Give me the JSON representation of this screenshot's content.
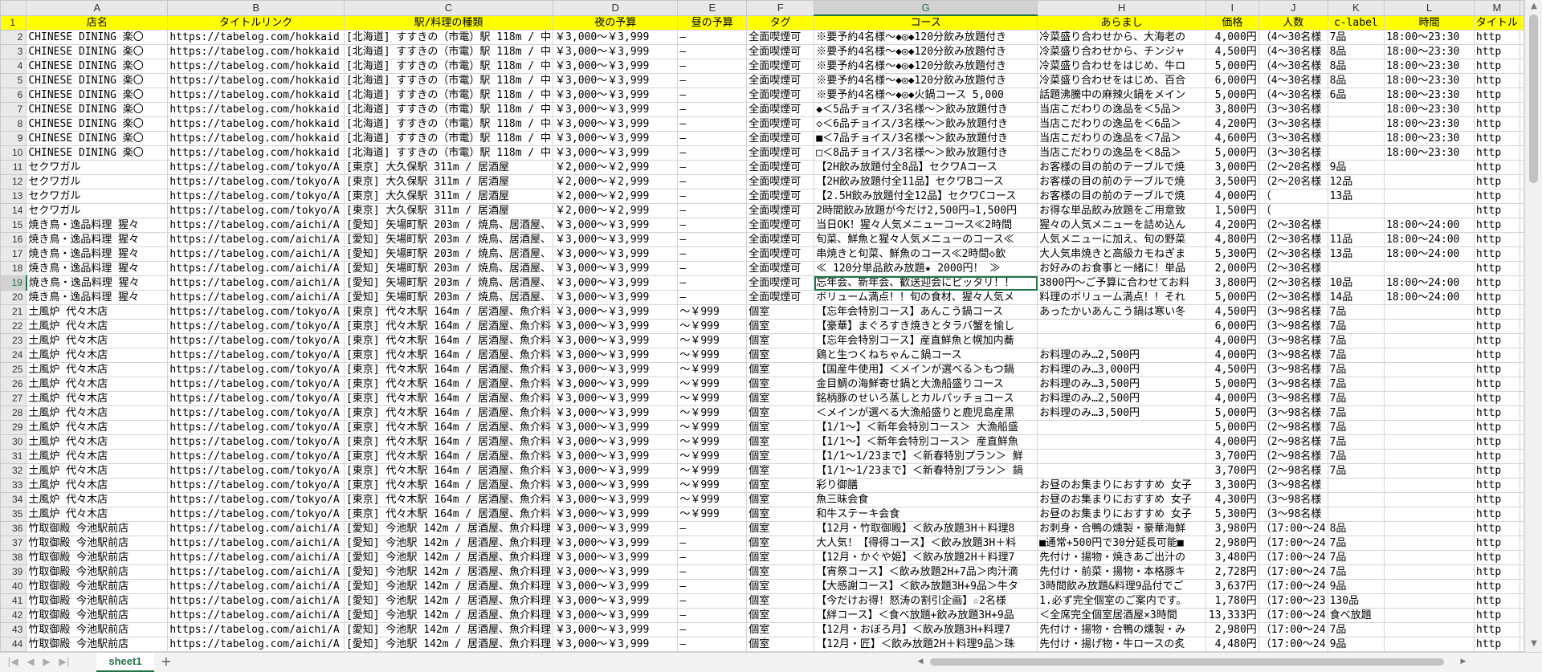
{
  "sheet": {
    "tab_label": "sheet1",
    "selected_cell": "G19"
  },
  "columns": [
    "A",
    "B",
    "C",
    "D",
    "E",
    "F",
    "G",
    "H",
    "I",
    "J",
    "K",
    "L",
    "M"
  ],
  "header_row": [
    "店名",
    "タイトルリンク",
    "駅/料理の種類",
    "夜の予算",
    "昼の予算",
    "タグ",
    "コース",
    "あらまし",
    "価格",
    "人数",
    "c-label",
    "時間",
    "タイトル"
  ],
  "rows": [
    [
      "CHINESE DINING 楽〇",
      "https://tabelog.com/hokkaid",
      "[北海道] すすきの（市電）駅 118m / 中",
      "￥3,000～￥3,999",
      "–",
      "全面喫煙可",
      "※要予約4名様～◆◎◆120分飲み放題付き",
      "冷菜盛り合わせから、大海老の",
      "4,000円",
      "（4～30名様",
      "7品",
      "18:00～23:30",
      "http"
    ],
    [
      "CHINESE DINING 楽〇",
      "https://tabelog.com/hokkaid",
      "[北海道] すすきの（市電）駅 118m / 中",
      "￥3,000～￥3,999",
      "–",
      "全面喫煙可",
      "※要予約4名様～◆◎◆120分飲み放題付き",
      "冷菜盛り合わせから、チンジャ",
      "4,500円",
      "（4～30名様",
      "8品",
      "18:00～23:30",
      "http"
    ],
    [
      "CHINESE DINING 楽〇",
      "https://tabelog.com/hokkaid",
      "[北海道] すすきの（市電）駅 118m / 中",
      "￥3,000～￥3,999",
      "–",
      "全面喫煙可",
      "※要予約4名様～◆◎◆120分飲み放題付き",
      "冷菜盛り合わせをはじめ、牛ロ",
      "5,000円",
      "（4～30名様",
      "8品",
      "18:00～23:30",
      "http"
    ],
    [
      "CHINESE DINING 楽〇",
      "https://tabelog.com/hokkaid",
      "[北海道] すすきの（市電）駅 118m / 中",
      "￥3,000～￥3,999",
      "–",
      "全面喫煙可",
      "※要予約4名様～◆◎◆120分飲み放題付き",
      "冷菜盛り合わせをはじめ、百合",
      "6,000円",
      "（4～30名様",
      "8品",
      "18:00～23:30",
      "http"
    ],
    [
      "CHINESE DINING 楽〇",
      "https://tabelog.com/hokkaid",
      "[北海道] すすきの（市電）駅 118m / 中",
      "￥3,000～￥3,999",
      "–",
      "全面喫煙可",
      "※要予約4名様～◆◎◆火鍋コース 5,000",
      "話題沸騰中の麻辣火鍋をメイン",
      "5,000円",
      "（4～30名様",
      "6品",
      "18:00～23:30",
      "http"
    ],
    [
      "CHINESE DINING 楽〇",
      "https://tabelog.com/hokkaid",
      "[北海道] すすきの（市電）駅 118m / 中",
      "￥3,000～￥3,999",
      "–",
      "全面喫煙可",
      "◆＜5品チョイス/3名様～＞飲み放題付き",
      "当店こだわりの逸品を＜5品＞",
      "3,800円",
      "（3～30名様",
      "",
      "18:00～23:30",
      "http"
    ],
    [
      "CHINESE DINING 楽〇",
      "https://tabelog.com/hokkaid",
      "[北海道] すすきの（市電）駅 118m / 中",
      "￥3,000～￥3,999",
      "–",
      "全面喫煙可",
      "◇＜6品チョイス/3名様～＞飲み放題付き",
      "当店こだわりの逸品を＜6品＞",
      "4,200円",
      "（3～30名様",
      "",
      "18:00～23:30",
      "http"
    ],
    [
      "CHINESE DINING 楽〇",
      "https://tabelog.com/hokkaid",
      "[北海道] すすきの（市電）駅 118m / 中",
      "￥3,000～￥3,999",
      "–",
      "全面喫煙可",
      "■＜7品チョイス/3名様～＞飲み放題付き",
      "当店こだわりの逸品を＜7品＞",
      "4,600円",
      "（3～30名様",
      "",
      "18:00～23:30",
      "http"
    ],
    [
      "CHINESE DINING 楽〇",
      "https://tabelog.com/hokkaid",
      "[北海道] すすきの（市電）駅 118m / 中",
      "￥3,000～￥3,999",
      "–",
      "全面喫煙可",
      "□＜8品チョイス/3名様～＞飲み放題付き",
      "当店こだわりの逸品を＜8品＞",
      "5,000円",
      "（3～30名様",
      "",
      "18:00～23:30",
      "http"
    ],
    [
      "セクワガル",
      "https://tabelog.com/tokyo/A",
      "[東京] 大久保駅 311m / 居酒屋",
      "￥2,000～￥2,999",
      "–",
      "全面喫煙可",
      "【2H飲み放題付全8品】セクワAコース",
      "お客様の目の前のテーブルで焼",
      "3,000円",
      "（2～20名様",
      "9品",
      "",
      "http"
    ],
    [
      "セクワガル",
      "https://tabelog.com/tokyo/A",
      "[東京] 大久保駅 311m / 居酒屋",
      "￥2,000～￥2,999",
      "–",
      "全面喫煙可",
      "【2H飲み放題付全11品】セクワBコース",
      "お客様の目の前のテーブルで焼",
      "3,500円",
      "（2～20名様",
      "12品",
      "",
      "http"
    ],
    [
      "セクワガル",
      "https://tabelog.com/tokyo/A",
      "[東京] 大久保駅 311m / 居酒屋",
      "￥2,000～￥2,999",
      "–",
      "全面喫煙可",
      "【2.5H飲み放題付全12品】セクワCコース",
      "お客様の目の前のテーブルで焼",
      "4,000円",
      "（",
      "13品",
      "",
      "http"
    ],
    [
      "セクワガル",
      "https://tabelog.com/tokyo/A",
      "[東京] 大久保駅 311m / 居酒屋",
      "￥2,000～￥2,999",
      "–",
      "全面喫煙可",
      "2時間飲み放題が今だけ2,500円⇒1,500円",
      "お得な単品飲み放題をご用意致",
      "1,500円",
      "（",
      "",
      "",
      "http"
    ],
    [
      "焼き鳥・逸品料理 猩々",
      "https://tabelog.com/aichi/A",
      "[愛知] 矢場町駅 203m / 焼鳥、居酒屋、",
      "￥3,000～￥3,999",
      "–",
      "全面喫煙可",
      "当日OK！猩々人気メニューコース≪2時間",
      "猩々の人気メニューを詰め込ん",
      "4,200円",
      "（2～30名様",
      "",
      "18:00～24:00",
      "http"
    ],
    [
      "焼き鳥・逸品料理 猩々",
      "https://tabelog.com/aichi/A",
      "[愛知] 矢場町駅 203m / 焼鳥、居酒屋、",
      "￥3,000～￥3,999",
      "–",
      "全面喫煙可",
      "旬菜、鮮魚と猩々人気メニューのコース≪",
      "人気メニューに加え、旬の野菜",
      "4,800円",
      "（2～30名様",
      "11品",
      "18:00～24:00",
      "http"
    ],
    [
      "焼き鳥・逸品料理 猩々",
      "https://tabelog.com/aichi/A",
      "[愛知] 矢場町駅 203m / 焼鳥、居酒屋、",
      "￥3,000～￥3,999",
      "–",
      "全面喫煙可",
      "串焼きと旬菜、鮮魚のコース≪2時間◇飲",
      "大人気串焼きと高級カモねぎま",
      "5,300円",
      "（2～30名様",
      "13品",
      "18:00～24:00",
      "http"
    ],
    [
      "焼き鳥・逸品料理 猩々",
      "https://tabelog.com/aichi/A",
      "[愛知] 矢場町駅 203m / 焼鳥、居酒屋、",
      "￥3,000～￥3,999",
      "–",
      "全面喫煙可",
      "≪ 120分単品飲み放題★ 2000円！ ≫",
      "お好みのお食事と一緒に！単品",
      "2,000円",
      "（2～30名様",
      "",
      "",
      "http"
    ],
    [
      "焼き鳥・逸品料理 猩々",
      "https://tabelog.com/aichi/A",
      "[愛知] 矢場町駅 203m / 焼鳥、居酒屋、",
      "￥3,000～￥3,999",
      "–",
      "全面喫煙可",
      "忘年会、新年会、歓送迎会にピッタリ！！",
      "3800円～ご予算に合わせてお料",
      "3,800円",
      "（2～30名様",
      "10品",
      "18:00～24:00",
      "http"
    ],
    [
      "焼き鳥・逸品料理 猩々",
      "https://tabelog.com/aichi/A",
      "[愛知] 矢場町駅 203m / 焼鳥、居酒屋、",
      "￥3,000～￥3,999",
      "–",
      "全面喫煙可",
      "ボリューム満点！！旬の食材、猩々人気メ",
      "料理のボリューム満点！！それ",
      "5,000円",
      "（2～30名様",
      "14品",
      "18:00～24:00",
      "http"
    ],
    [
      "土風炉 代々木店",
      "https://tabelog.com/tokyo/A",
      "[東京] 代々木駅 164m / 居酒屋、魚介料",
      "￥3,000～￥3,999",
      "～￥999",
      "個室",
      "【忘年会特別コース】あんこう鍋コース",
      "あったかいあんこう鍋は寒い冬",
      "4,500円",
      "（3～98名様",
      "7品",
      "",
      "http"
    ],
    [
      "土風炉 代々木店",
      "https://tabelog.com/tokyo/A",
      "[東京] 代々木駅 164m / 居酒屋、魚介料",
      "￥3,000～￥3,999",
      "～￥999",
      "個室",
      "【豪華】まぐろすき焼きとタラバ蟹を愉し",
      "",
      "6,000円",
      "（3～98名様",
      "7品",
      "",
      "http"
    ],
    [
      "土風炉 代々木店",
      "https://tabelog.com/tokyo/A",
      "[東京] 代々木駅 164m / 居酒屋、魚介料",
      "￥3,000～￥3,999",
      "～￥999",
      "個室",
      "【忘年会特別コース】産直鮮魚と幌加内蕎",
      "",
      "4,000円",
      "（3～98名様",
      "7品",
      "",
      "http"
    ],
    [
      "土風炉 代々木店",
      "https://tabelog.com/tokyo/A",
      "[東京] 代々木駅 164m / 居酒屋、魚介料",
      "￥3,000～￥3,999",
      "～￥999",
      "個室",
      "鶏と生つくねちゃんこ鍋コース",
      "お料理のみ…2,500円",
      "4,000円",
      "（3～98名様",
      "7品",
      "",
      "http"
    ],
    [
      "土風炉 代々木店",
      "https://tabelog.com/tokyo/A",
      "[東京] 代々木駅 164m / 居酒屋、魚介料",
      "￥3,000～￥3,999",
      "～￥999",
      "個室",
      "【国産牛使用】＜メインが選べる＞もつ鍋",
      "お料理のみ…3,000円",
      "4,500円",
      "（3～98名様",
      "7品",
      "",
      "http"
    ],
    [
      "土風炉 代々木店",
      "https://tabelog.com/tokyo/A",
      "[東京] 代々木駅 164m / 居酒屋、魚介料",
      "￥3,000～￥3,999",
      "～￥999",
      "個室",
      "金目鯛の海鮮寄せ鍋と大漁船盛りコース",
      "お料理のみ…3,500円",
      "5,000円",
      "（3～98名様",
      "7品",
      "",
      "http"
    ],
    [
      "土風炉 代々木店",
      "https://tabelog.com/tokyo/A",
      "[東京] 代々木駅 164m / 居酒屋、魚介料",
      "￥3,000～￥3,999",
      "～￥999",
      "個室",
      "銘柄豚のせいろ蒸しとカルパッチョコース",
      "お料理のみ…2,500円",
      "4,000円",
      "（3～98名様",
      "7品",
      "",
      "http"
    ],
    [
      "土風炉 代々木店",
      "https://tabelog.com/tokyo/A",
      "[東京] 代々木駅 164m / 居酒屋、魚介料",
      "￥3,000～￥3,999",
      "～￥999",
      "個室",
      "＜メインが選べる大漁船盛りと鹿児島産黒",
      "お料理のみ…3,500円",
      "5,000円",
      "（3～98名様",
      "7品",
      "",
      "http"
    ],
    [
      "土風炉 代々木店",
      "https://tabelog.com/tokyo/A",
      "[東京] 代々木駅 164m / 居酒屋、魚介料",
      "￥3,000～￥3,999",
      "～￥999",
      "個室",
      "【1/1～】＜新年会特別コース＞ 大漁船盛",
      "",
      "5,000円",
      "（2～98名様",
      "7品",
      "",
      "http"
    ],
    [
      "土風炉 代々木店",
      "https://tabelog.com/tokyo/A",
      "[東京] 代々木駅 164m / 居酒屋、魚介料",
      "￥3,000～￥3,999",
      "～￥999",
      "個室",
      "【1/1～】＜新年会特別コース＞ 産直鮮魚",
      "",
      "4,000円",
      "（2～98名様",
      "7品",
      "",
      "http"
    ],
    [
      "土風炉 代々木店",
      "https://tabelog.com/tokyo/A",
      "[東京] 代々木駅 164m / 居酒屋、魚介料",
      "￥3,000～￥3,999",
      "～￥999",
      "個室",
      "【1/1～1/23まで】＜新春特別プラン＞ 鮮",
      "",
      "3,700円",
      "（2～98名様",
      "7品",
      "",
      "http"
    ],
    [
      "土風炉 代々木店",
      "https://tabelog.com/tokyo/A",
      "[東京] 代々木駅 164m / 居酒屋、魚介料",
      "￥3,000～￥3,999",
      "～￥999",
      "個室",
      "【1/1～1/23まで】＜新春特別プラン＞ 鍋",
      "",
      "3,700円",
      "（2～98名様",
      "7品",
      "",
      "http"
    ],
    [
      "土風炉 代々木店",
      "https://tabelog.com/tokyo/A",
      "[東京] 代々木駅 164m / 居酒屋、魚介料",
      "￥3,000～￥3,999",
      "～￥999",
      "個室",
      "彩り御膳",
      "お昼のお集まりにおすすめ 女子",
      "3,300円",
      "（3～98名様",
      "",
      "",
      "http"
    ],
    [
      "土風炉 代々木店",
      "https://tabelog.com/tokyo/A",
      "[東京] 代々木駅 164m / 居酒屋、魚介料",
      "￥3,000～￥3,999",
      "～￥999",
      "個室",
      "魚三昧会食",
      "お昼のお集まりにおすすめ 女子",
      "4,300円",
      "（3～98名様",
      "",
      "",
      "http"
    ],
    [
      "土風炉 代々木店",
      "https://tabelog.com/tokyo/A",
      "[東京] 代々木駅 164m / 居酒屋、魚介料",
      "￥3,000～￥3,999",
      "～￥999",
      "個室",
      "和牛ステーキ会食",
      "お昼のお集まりにおすすめ 女子",
      "5,300円",
      "（3～98名様",
      "",
      "",
      "http"
    ],
    [
      "竹取御殿 今池駅前店",
      "https://tabelog.com/aichi/A",
      "[愛知] 今池駅 142m / 居酒屋、魚介料理",
      "￥3,000～￥3,999",
      "–",
      "個室",
      "【12月・竹取御殿】＜飲み放題3H＋料理8",
      "お刺身・合鴨の燻製・豪華海鮮",
      "3,980円",
      "（17:00～24",
      "8品",
      "",
      "http"
    ],
    [
      "竹取御殿 今池駅前店",
      "https://tabelog.com/aichi/A",
      "[愛知] 今池駅 142m / 居酒屋、魚介料理",
      "￥3,000～￥3,999",
      "–",
      "個室",
      "大人気！【得得コース】＜飲み放題3H＋料",
      "■通常+500円で30分延長可能■",
      "2,980円",
      "（17:00～24",
      "7品",
      "",
      "http"
    ],
    [
      "竹取御殿 今池駅前店",
      "https://tabelog.com/aichi/A",
      "[愛知] 今池駅 142m / 居酒屋、魚介料理",
      "￥3,000～￥3,999",
      "–",
      "個室",
      "【12月・かぐや姫】＜飲み放題2H＋料理7",
      "先付け・揚物・焼きあご出汁の",
      "3,480円",
      "（17:00～24",
      "7品",
      "",
      "http"
    ],
    [
      "竹取御殿 今池駅前店",
      "https://tabelog.com/aichi/A",
      "[愛知] 今池駅 142m / 居酒屋、魚介料理",
      "￥3,000～￥3,999",
      "–",
      "個室",
      "【宵祭コース】＜飲み放題2H+7品＞肉汁滴",
      "先付け・前菜・揚物・本格豚キ",
      "2,728円",
      "（17:00～24",
      "7品",
      "",
      "http"
    ],
    [
      "竹取御殿 今池駅前店",
      "https://tabelog.com/aichi/A",
      "[愛知] 今池駅 142m / 居酒屋、魚介料理",
      "￥3,000～￥3,999",
      "–",
      "個室",
      "【大感謝コース】＜飲み放題3H+9品＞牛タ",
      "3時間飲み放題&料理9品付でご",
      "3,637円",
      "（17:00～24",
      "9品",
      "",
      "http"
    ],
    [
      "竹取御殿 今池駅前店",
      "https://tabelog.com/aichi/A",
      "[愛知] 今池駅 142m / 居酒屋、魚介料理",
      "￥3,000～￥3,999",
      "–",
      "個室",
      "【今だけお得！怒涛の割引企画】☆2名様",
      "1.必ず完全個室のご案内です。",
      "1,780円",
      "（17:00～23",
      "130品",
      "",
      "http"
    ],
    [
      "竹取御殿 今池駅前店",
      "https://tabelog.com/aichi/A",
      "[愛知] 今池駅 142m / 居酒屋、魚介料理",
      "￥3,000～￥3,999",
      "–",
      "個室",
      "【絆コース】＜食べ放題+飲み放題3H+9品",
      "＜全席完全個室居酒屋×3時間",
      "13,333円",
      "（17:00～24",
      "食べ放題",
      "",
      "http"
    ],
    [
      "竹取御殿 今池駅前店",
      "https://tabelog.com/aichi/A",
      "[愛知] 今池駅 142m / 居酒屋、魚介料理",
      "￥3,000～￥3,999",
      "–",
      "個室",
      "【12月・おぼろ月】＜飲み放題3H+料理7",
      "先付け・揚物・合鴨の燻製・み",
      "2,980円",
      "（17:00～24",
      "7品",
      "",
      "http"
    ],
    [
      "竹取御殿 今池駅前店",
      "https://tabelog.com/aichi/A",
      "[愛知] 今池駅 142m / 居酒屋、魚介料理",
      "￥3,000～￥3,999",
      "–",
      "個室",
      "【12月・匠】＜飲み放題2H＋料理9品＞珠",
      "先付け・揚げ物・牛ロースの炙",
      "4,480円",
      "（17:00～24",
      "9品",
      "",
      "http"
    ]
  ]
}
